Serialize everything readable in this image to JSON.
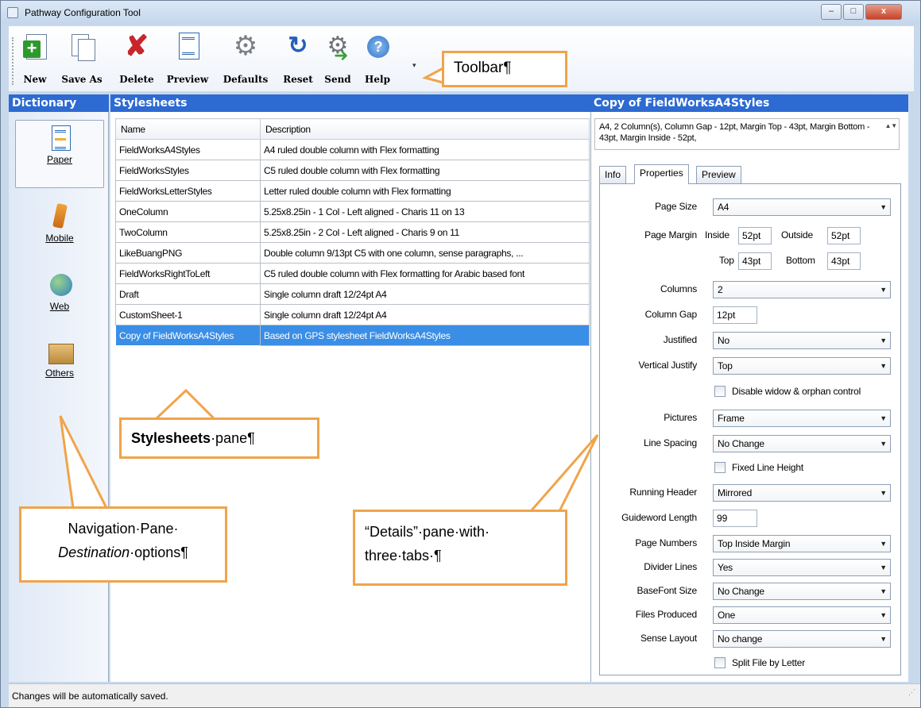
{
  "window": {
    "title": "Pathway Configuration Tool",
    "min": "–",
    "max": "□",
    "close": "x"
  },
  "toolbar": {
    "buttons": [
      {
        "label": "New",
        "icon": "new-document-icon"
      },
      {
        "label": "Save As",
        "icon": "save-as-icon"
      },
      {
        "label": "Delete",
        "icon": "delete-icon"
      },
      {
        "label": "Preview",
        "icon": "preview-icon"
      },
      {
        "label": "Defaults",
        "icon": "gear-icon"
      },
      {
        "label": "Reset",
        "icon": "reset-icon"
      },
      {
        "label": "Send",
        "icon": "send-icon"
      },
      {
        "label": "Help",
        "icon": "help-icon"
      }
    ],
    "more": "▾"
  },
  "headers": {
    "dictionary": "Dictionary",
    "stylesheets": "Stylesheets",
    "details": "Copy of FieldWorksA4Styles"
  },
  "nav": [
    {
      "label": "Paper",
      "icon": "paper-icon",
      "selected": true
    },
    {
      "label": "Mobile",
      "icon": "mobile-icon",
      "selected": false
    },
    {
      "label": "Web",
      "icon": "web-icon",
      "selected": false
    },
    {
      "label": "Others",
      "icon": "others-icon",
      "selected": false
    }
  ],
  "stylesheets": {
    "columns": [
      "Name",
      "Description"
    ],
    "rows": [
      [
        "FieldWorksA4Styles",
        "A4 ruled double column with Flex formatting"
      ],
      [
        "FieldWorksStyles",
        "C5 ruled double column with Flex formatting"
      ],
      [
        "FieldWorksLetterStyles",
        "Letter ruled double column with Flex formatting"
      ],
      [
        "OneColumn",
        "5.25x8.25in - 1 Col - Left aligned - Charis 11 on 13"
      ],
      [
        "TwoColumn",
        "5.25x8.25in - 2 Col - Left aligned - Charis 9 on 11"
      ],
      [
        "LikeBuangPNG",
        "Double column 9/13pt C5 with one column, sense paragraphs, ..."
      ],
      [
        "FieldWorksRightToLeft",
        "C5 ruled double column with Flex formatting for Arabic based font"
      ],
      [
        "Draft",
        "Single column draft 12/24pt A4"
      ],
      [
        "CustomSheet-1",
        "Single column draft 12/24pt A4"
      ],
      [
        "Copy of FieldWorksA4Styles",
        "Based on GPS stylesheet FieldWorksA4Styles"
      ]
    ],
    "selected_index": 9
  },
  "details": {
    "summary": "A4, 2 Column(s),  Column Gap - 12pt,  Margin Top - 43pt,  Margin Bottom - 43pt,  Margin Inside - 52pt,",
    "summary_scroll": "▲▼",
    "tabs": [
      "Info",
      "Properties",
      "Preview"
    ],
    "active_tab": "Properties",
    "page_size_label": "Page Size",
    "page_size": "A4",
    "page_margin_label": "Page Margin",
    "inside_label": "Inside",
    "inside": "52pt",
    "outside_label": "Outside",
    "outside": "52pt",
    "top_label": "Top",
    "top": "43pt",
    "bottom_label": "Bottom",
    "bottom": "43pt",
    "columns_label": "Columns",
    "columns": "2",
    "column_gap_label": "Column Gap",
    "column_gap": "12pt",
    "justified_label": "Justified",
    "justified": "No",
    "vertical_justify_label": "Vertical Justify",
    "vertical_justify": "Top",
    "disable_widow_label": "Disable widow & orphan control",
    "pictures_label": "Pictures",
    "pictures": "Frame",
    "line_spacing_label": "Line Spacing",
    "line_spacing": "No Change",
    "fixed_line_height_label": "Fixed Line Height",
    "running_header_label": "Running Header",
    "running_header": "Mirrored",
    "guideword_label": "Guideword Length",
    "guideword": "99",
    "page_numbers_label": "Page Numbers",
    "page_numbers": "Top Inside Margin",
    "divider_lines_label": "Divider Lines",
    "divider_lines": "Yes",
    "basefont_label": "BaseFont Size",
    "basefont": "No Change",
    "files_produced_label": "Files Produced",
    "files_produced": "One",
    "sense_layout_label": "Sense Layout",
    "sense_layout": "No change",
    "split_file_label": "Split File by Letter"
  },
  "status": "Changes will be automatically saved.",
  "callouts": {
    "toolbar": "Toolbar¶",
    "stylesheets_bold": "Stylesheets",
    "stylesheets_rest": "·pane¶",
    "nav_line1": "Navigation·Pane·",
    "nav_italic": "Destination",
    "nav_rest": "·options¶",
    "details_line1": "“Details”·pane·with·",
    "details_line2": "three·tabs·¶"
  },
  "colors": {
    "header_blue": "#2d6ad2",
    "selection": "#3a8ee6",
    "callout_border": "#f0a44a"
  }
}
